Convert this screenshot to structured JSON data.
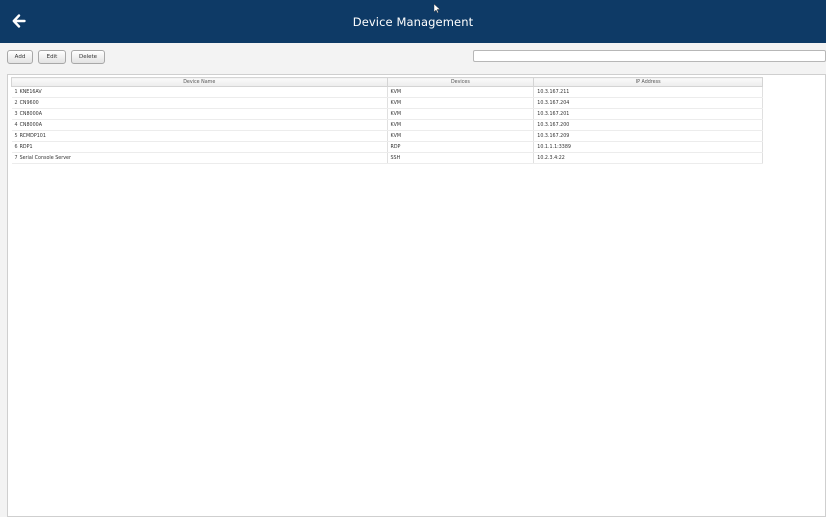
{
  "header": {
    "title": "Device Management",
    "back_icon": "arrow-left-icon",
    "background": "#0e3a66"
  },
  "toolbar": {
    "add_label": "Add",
    "edit_label": "Edit",
    "delete_label": "Delete"
  },
  "search": {
    "value": "",
    "placeholder": ""
  },
  "table": {
    "columns": [
      "Device Name",
      "Devices",
      "IP Address"
    ],
    "rows": [
      {
        "index": "1",
        "name": "KNE16AV",
        "type": "KVM",
        "ip": "10.3.167.211"
      },
      {
        "index": "2",
        "name": "CN9600",
        "type": "KVM",
        "ip": "10.3.167.204"
      },
      {
        "index": "3",
        "name": "CN8000A",
        "type": "KVM",
        "ip": "10.3.167.201"
      },
      {
        "index": "4",
        "name": "CN8000A",
        "type": "KVM",
        "ip": "10.3.167.200"
      },
      {
        "index": "5",
        "name": "RCMDP101",
        "type": "KVM",
        "ip": "10.3.167.209"
      },
      {
        "index": "6",
        "name": "RDP1",
        "type": "RDP",
        "ip": "10.1.1.1:3389"
      },
      {
        "index": "7",
        "name": "Serial Console Server",
        "type": "SSH",
        "ip": "10.2.3.4:22"
      }
    ]
  }
}
